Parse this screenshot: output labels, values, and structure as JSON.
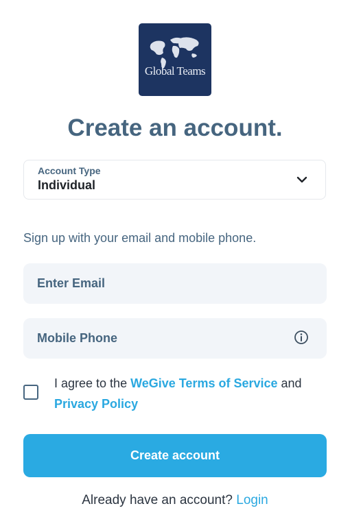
{
  "logo": {
    "text": "Global Teams",
    "bg_color": "#1d3461"
  },
  "title": "Create an account.",
  "account_type": {
    "label": "Account Type",
    "value": "Individual",
    "icon": "chevron-down-icon"
  },
  "subtitle": "Sign up with your email and mobile phone.",
  "email": {
    "placeholder": "Enter Email",
    "value": ""
  },
  "phone": {
    "placeholder": "Mobile Phone",
    "value": "",
    "icon": "info-icon"
  },
  "agreement": {
    "checked": false,
    "prefix": "I agree to the ",
    "terms_link": "WeGive Terms of Service",
    "middle": " and",
    "privacy_link": "Privacy Policy"
  },
  "submit_label": "Create account",
  "footer": {
    "text": "Already have an account? ",
    "login_link": "Login"
  },
  "colors": {
    "accent": "#2aaae2",
    "heading": "#46657f",
    "field_bg": "#f2f5f9"
  }
}
